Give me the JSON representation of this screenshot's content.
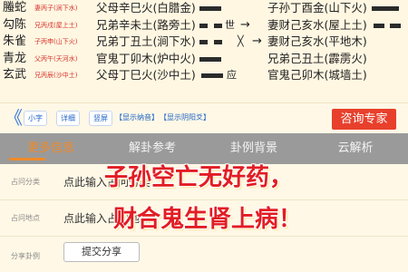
{
  "gua": {
    "rows": [
      {
        "god": "螣蛇",
        "month": "妻丙子(涧下水)",
        "line": "父母辛巳火(白腊金)",
        "mark": "",
        "arrow": "",
        "changed": "子孙丁酉金(山下火)"
      },
      {
        "god": "勾陈",
        "month": "兄丙戌(屋上土)",
        "line": "兄弟辛未土(路旁土)",
        "mark": "世",
        "arrow": "→",
        "changed": "妻财己亥水(屋上土)"
      },
      {
        "god": "朱雀",
        "month": "子丙申(山下火)",
        "line": "兄弟丁丑土(涧下水)",
        "mark": "╳",
        "arrow": "→",
        "changed": "兄弟己丑土(霹雳火)"
      },
      {
        "god": "青龙",
        "month": "父丙午(天河水)",
        "line": "官鬼丁卯木(炉中火)",
        "mark": "",
        "arrow": "",
        "changed": "兄弟己丑土(霹雳火)"
      },
      {
        "god": "玄武",
        "month": "兄丙辰(沙中土)",
        "line": "父母丁巳火(沙中土)",
        "mark": "应",
        "arrow": "",
        "changed": "官鬼己卯木(城墙土)"
      }
    ],
    "row4_changed": "妻财己亥水(平地木)"
  },
  "toolbar": {
    "back_icon": "chevron-left-icon",
    "btn_small_text": "小字",
    "btn_detail": "详细",
    "btn_vertical": "竖屏",
    "link_nayin": "【显示纳音】",
    "link_hidden": "【显示阴阳爻】",
    "consult": "咨询专家"
  },
  "tabs": [
    {
      "label": "更多信息",
      "active": true
    },
    {
      "label": "解卦参考",
      "active": false
    },
    {
      "label": "卦例背景",
      "active": false
    },
    {
      "label": "云解析",
      "active": false
    }
  ],
  "form": {
    "question_type_label": "占问分类",
    "question_type_value": "点此输入占问分类",
    "question_place_label": "占问地点",
    "question_place_value": "点此输入占问地点",
    "share_label": "分享卦例",
    "share_button": "提交分享"
  },
  "slogan": {
    "line1": "子孙空亡无好药，",
    "line2": "财合鬼生肾上病！"
  },
  "colors": {
    "accent_red": "#e8402c",
    "tab_active": "#f08a2a",
    "tab_bar": "#9a9a9a",
    "link_blue": "#1d63c6"
  }
}
